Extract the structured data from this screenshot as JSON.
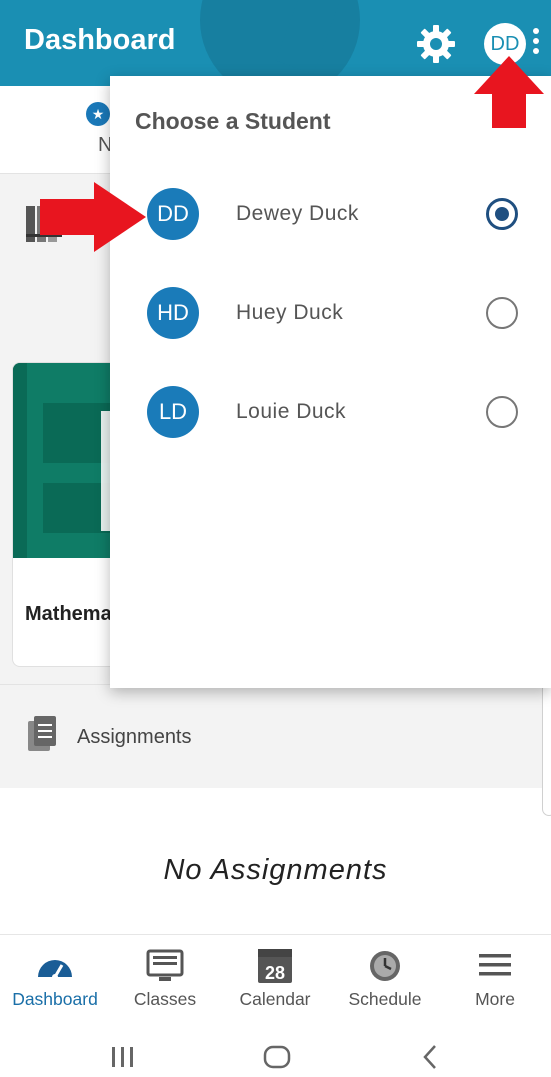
{
  "header": {
    "title": "Dashboard",
    "avatar_initials": "DD",
    "settings_icon": "gear-icon",
    "menu_icon": "kebab-menu-icon"
  },
  "background": {
    "course_name": "Mathema",
    "section_label": "Assignments",
    "empty_message": "No Assignments",
    "tab_letter": "N"
  },
  "student_picker": {
    "title": "Choose a Student",
    "students": [
      {
        "initials": "DD",
        "name": "Dewey Duck",
        "selected": true
      },
      {
        "initials": "HD",
        "name": "Huey Duck",
        "selected": false
      },
      {
        "initials": "LD",
        "name": "Louie Duck",
        "selected": false
      }
    ]
  },
  "bottom_nav": {
    "items": [
      {
        "label": "Dashboard",
        "icon": "speedometer-icon",
        "active": true
      },
      {
        "label": "Classes",
        "icon": "monitor-icon",
        "active": false
      },
      {
        "label": "Calendar",
        "icon": "calendar-icon",
        "active": false,
        "badge": "28"
      },
      {
        "label": "Schedule",
        "icon": "clock-icon",
        "active": false
      },
      {
        "label": "More",
        "icon": "hamburger-icon",
        "active": false
      }
    ]
  },
  "colors": {
    "header": "#1a8fb3",
    "avatar": "#1a7bb9",
    "radio_selected": "#1f4f80",
    "annotation_arrow": "#e8151f",
    "nav_active": "#1a6fa8"
  }
}
